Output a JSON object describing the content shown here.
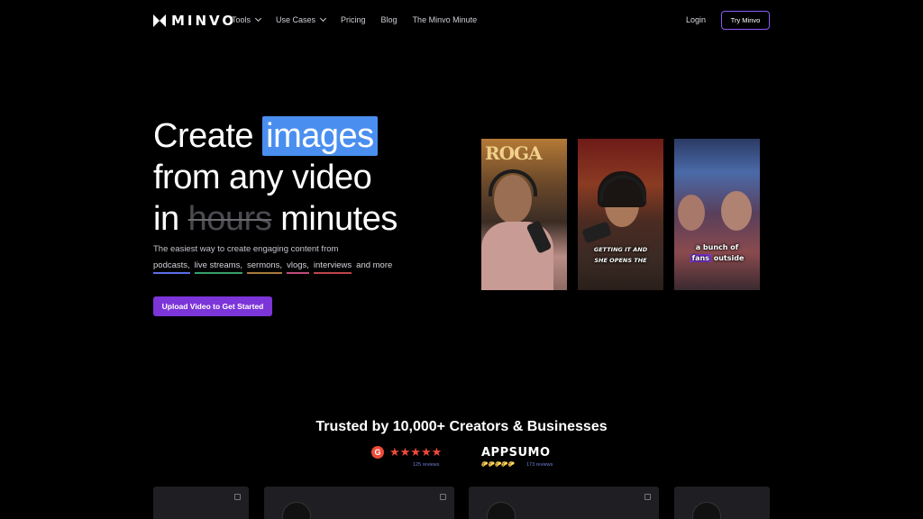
{
  "nav": {
    "logo_text": "MINVO",
    "links": [
      {
        "label": "Tools",
        "dropdown": true
      },
      {
        "label": "Use Cases",
        "dropdown": true
      },
      {
        "label": "Pricing",
        "dropdown": false
      },
      {
        "label": "Blog",
        "dropdown": false
      },
      {
        "label": "The Minvo Minute",
        "dropdown": false
      }
    ],
    "login": "Login",
    "try_button": "Try Minvo"
  },
  "hero": {
    "line1_prefix": "Create",
    "line1_highlight": "images",
    "line2": "from any video",
    "line3_prefix": "in",
    "line3_strike": "hours",
    "line3_suffix": "minutes",
    "subtitle": "The easiest way to create engaging content from",
    "tags": [
      "podcasts,",
      "live streams,",
      "sermons,",
      "vlogs,",
      "interviews"
    ],
    "tags_suffix": "and more",
    "cta": "Upload Video to Get Started"
  },
  "videos": [
    {
      "caption_line1": "",
      "caption_line2": "",
      "sign": "ROGA"
    },
    {
      "caption_line1": "GETTING IT AND",
      "caption_line2": "SHE OPENS THE"
    },
    {
      "caption_line1": "a bunch of",
      "caption_highlight": "fans",
      "caption_rest": "outside"
    }
  ],
  "trust": {
    "heading": "Trusted by 10,000+ Creators & Businesses",
    "g2": {
      "logo": "G",
      "stars": "★★★★★",
      "reviews": "125 reviews"
    },
    "appsumo": {
      "logo": "APPSUMO",
      "tacos": "🌮🌮🌮🌮🌮",
      "reviews": "173 reviews"
    }
  },
  "colors": {
    "accent_purple": "#7c35d8",
    "highlight_blue": "#4a8ff0",
    "g2_red": "#ef4a3a",
    "tag_underlines": [
      "#5b6ee8",
      "#39a06a",
      "#a87a3a",
      "#c04c7a",
      "#c0444a"
    ]
  }
}
